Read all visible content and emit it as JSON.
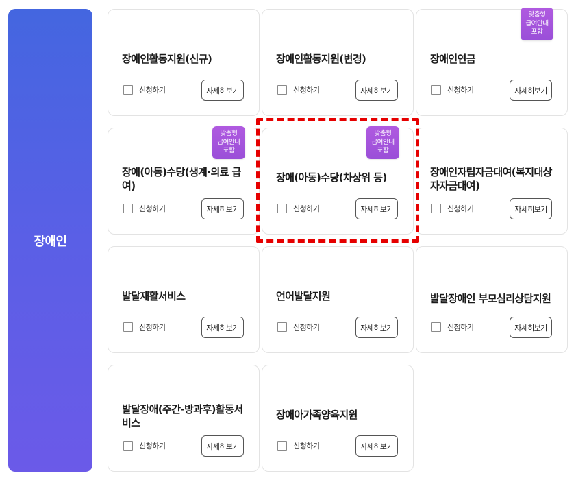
{
  "category": {
    "label": "장애인"
  },
  "common": {
    "apply_label": "신청하기",
    "detail_label": "자세히보기"
  },
  "badge": {
    "lines": [
      "맞춤형",
      "급여안내",
      "포함"
    ]
  },
  "cards": [
    {
      "title": "장애인활동지원(신규)",
      "badge": false
    },
    {
      "title": "장애인활동지원(변경)",
      "badge": false
    },
    {
      "title": "장애인연금",
      "badge": true
    },
    {
      "title": "장애(아동)수당(생계·의료 급여)",
      "badge": true
    },
    {
      "title": "장애(아동)수당(차상위 등)",
      "badge": true,
      "highlighted": true
    },
    {
      "title": "장애인자립자금대여(복지대상자자금대여)",
      "badge": false
    },
    {
      "title": "발달재활서비스",
      "badge": false
    },
    {
      "title": "언어발달지원",
      "badge": false
    },
    {
      "title": "발달장애인 부모심리상담지원",
      "badge": false
    },
    {
      "title": "발달장애(주간-방과후)활동서비스",
      "badge": false
    },
    {
      "title": "장애아가족양육지원",
      "badge": false
    }
  ]
}
